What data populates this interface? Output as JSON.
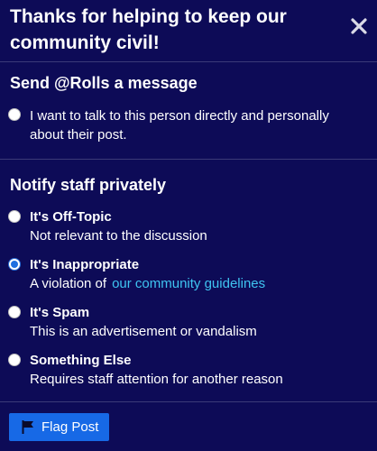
{
  "modal": {
    "title": "Thanks for helping to keep our community civil!",
    "close_icon": "close-icon"
  },
  "message_section": {
    "title": "Send @Rolls a message",
    "option": {
      "label": "I want to talk to this person directly and personally about their post.",
      "selected": false
    }
  },
  "staff_section": {
    "title": "Notify staff privately",
    "options": [
      {
        "title": "It's Off-Topic",
        "description": "Not relevant to the discussion",
        "selected": false
      },
      {
        "title": "It's Inappropriate",
        "description": "A violation of",
        "link": "our community guidelines",
        "selected": true
      },
      {
        "title": "It's Spam",
        "description": "This is an advertisement or vandalism",
        "selected": false
      },
      {
        "title": "Something Else",
        "description": "Requires staff attention for another reason",
        "selected": false
      }
    ]
  },
  "footer": {
    "flag_button_label": "Flag Post",
    "flag_icon": "flag-icon"
  },
  "colors": {
    "background": "#0d0b57",
    "accent": "#1769e6",
    "link": "#3fc4f1"
  }
}
